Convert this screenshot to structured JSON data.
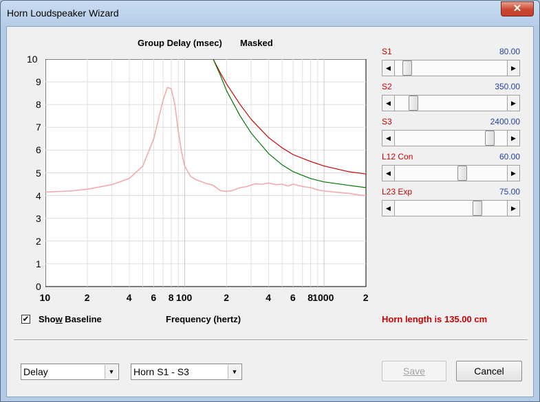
{
  "window": {
    "title": "Horn Loudspeaker Wizard",
    "close_glyph": "✕"
  },
  "chart": {
    "title": "Group Delay (msec)",
    "mode": "Masked",
    "xlabel": "Frequency (hertz)",
    "y_ticks": [
      "0",
      "1",
      "2",
      "3",
      "4",
      "5",
      "6",
      "7",
      "8",
      "9",
      "10"
    ],
    "x_ticks": [
      {
        "v": 10,
        "t": "10"
      },
      {
        "v": 20,
        "t": "2"
      },
      {
        "v": 40,
        "t": "4"
      },
      {
        "v": 60,
        "t": "6"
      },
      {
        "v": 80,
        "t": "8"
      },
      {
        "v": 100,
        "t": "100"
      },
      {
        "v": 200,
        "t": "2"
      },
      {
        "v": 400,
        "t": "4"
      },
      {
        "v": 600,
        "t": "6"
      },
      {
        "v": 800,
        "t": "8"
      },
      {
        "v": 1000,
        "t": "1000"
      },
      {
        "v": 2000,
        "t": "2"
      }
    ]
  },
  "chart_data": {
    "type": "line",
    "title": "Group Delay (msec)   Masked",
    "xlabel": "Frequency (hertz)",
    "ylabel": "",
    "xscale": "log",
    "xlim": [
      10,
      2000
    ],
    "ylim": [
      0,
      10
    ],
    "grid": true,
    "series": [
      {
        "color": "#f2aaaa",
        "x": [
          10,
          15,
          20,
          30,
          40,
          50,
          60,
          65,
          70,
          75,
          80,
          85,
          90,
          95,
          100,
          110,
          120,
          140,
          160,
          180,
          200,
          220,
          250,
          280,
          320,
          360,
          400,
          450,
          500,
          550,
          600,
          700,
          800,
          900,
          1000,
          1200,
          1500,
          1800,
          2000
        ],
        "y": [
          4.15,
          4.2,
          4.28,
          4.48,
          4.75,
          5.3,
          6.5,
          7.4,
          8.2,
          8.75,
          8.7,
          8.0,
          6.8,
          5.9,
          5.3,
          4.85,
          4.7,
          4.55,
          4.45,
          4.22,
          4.18,
          4.22,
          4.35,
          4.4,
          4.52,
          4.5,
          4.55,
          4.48,
          4.5,
          4.42,
          4.5,
          4.4,
          4.35,
          4.25,
          4.2,
          4.15,
          4.1,
          4.02,
          4.0
        ]
      },
      {
        "color": "#cc0000",
        "x": [
          160,
          180,
          200,
          250,
          300,
          400,
          500,
          600,
          800,
          1000,
          1500,
          2000
        ],
        "y": [
          10,
          9.4,
          8.9,
          8.0,
          7.35,
          6.55,
          6.1,
          5.8,
          5.5,
          5.3,
          5.05,
          4.95
        ]
      },
      {
        "color": "#007700",
        "x": [
          160,
          180,
          200,
          250,
          300,
          400,
          500,
          600,
          800,
          1000,
          1500,
          2000
        ],
        "y": [
          10,
          9.3,
          8.6,
          7.5,
          6.75,
          5.85,
          5.35,
          5.05,
          4.75,
          4.6,
          4.45,
          4.35
        ]
      }
    ]
  },
  "sliders": [
    {
      "label": "S1",
      "value": "80.00",
      "level": 0.07
    },
    {
      "label": "S2",
      "value": "350.00",
      "level": 0.13
    },
    {
      "label": "S3",
      "value": "2400.00",
      "level": 0.87
    },
    {
      "label": "L12  Con",
      "value": "60.00",
      "level": 0.6
    },
    {
      "label": "L23  Exp",
      "value": "75.00",
      "level": 0.75
    }
  ],
  "baseline": {
    "label_pre": "Sho",
    "label_key": "w",
    "label_post": " Baseline",
    "checked": true,
    "check_glyph": "✔"
  },
  "horn_length": "Horn length is 135.00 cm",
  "view_select": "Delay",
  "range_select": "Horn S1 - S3",
  "buttons": {
    "save": "Save",
    "cancel": "Cancel"
  },
  "glyphs": {
    "left": "◀",
    "right": "▶",
    "down": "▼"
  },
  "colors": {
    "accent_red": "#cc0000",
    "value_blue": "#1f3fa8"
  }
}
